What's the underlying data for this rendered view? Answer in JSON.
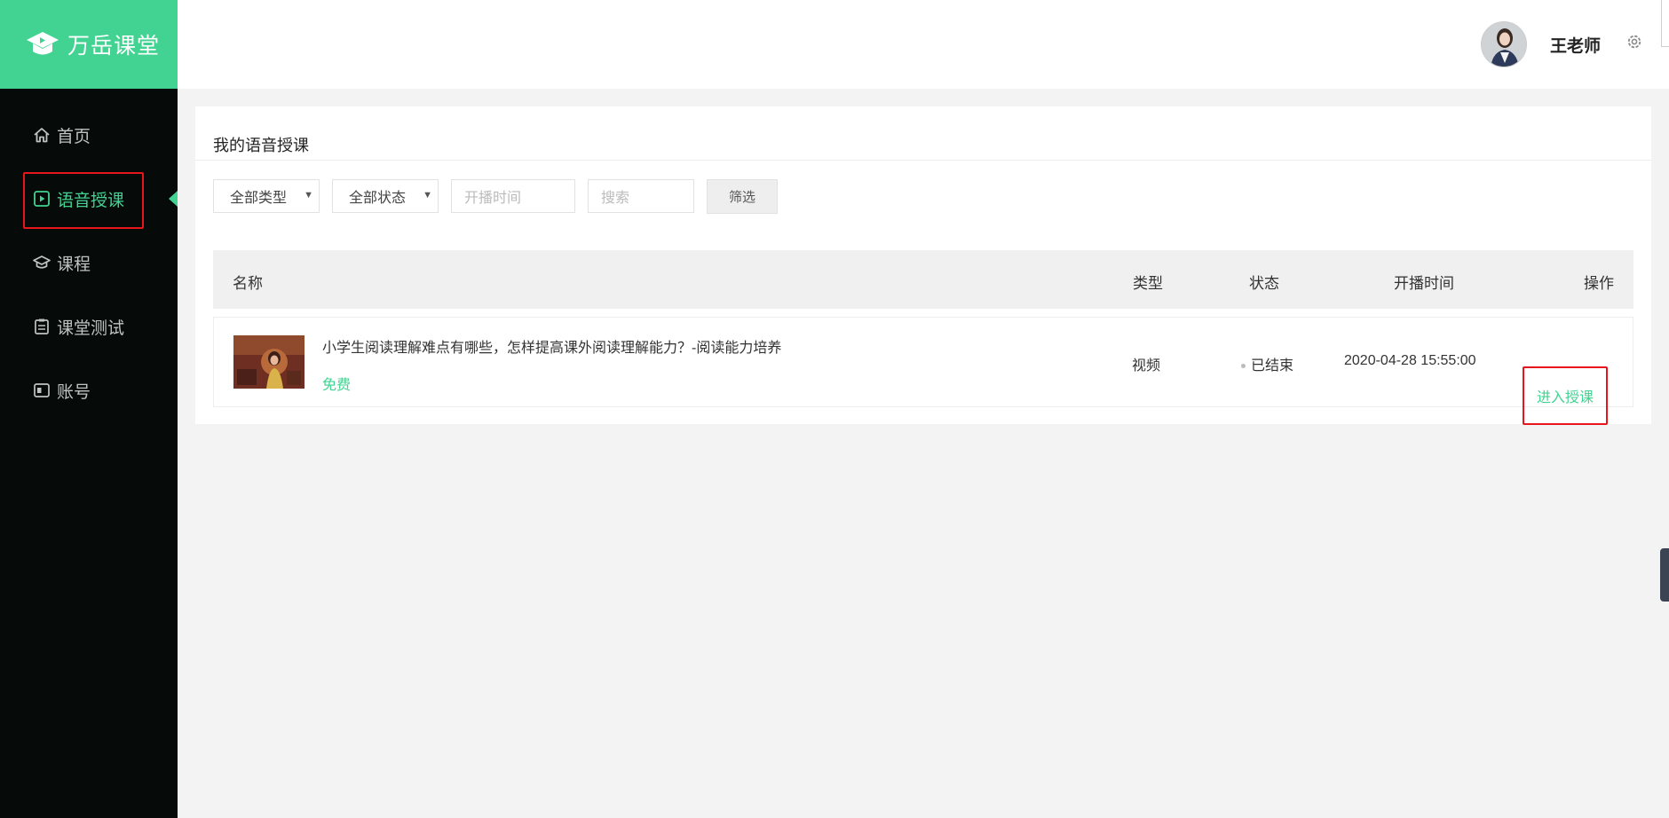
{
  "brand": {
    "name": "万岳课堂",
    "color": "#42d392",
    "icon": "graduation-cap-play-icon"
  },
  "sidebar": {
    "items": [
      {
        "label": "首页",
        "icon": "home-icon",
        "active": false
      },
      {
        "label": "语音授课",
        "icon": "play-square-icon",
        "active": true
      },
      {
        "label": "课程",
        "icon": "graduation-cap-icon",
        "active": false
      },
      {
        "label": "课堂测试",
        "icon": "clipboard-icon",
        "active": false
      },
      {
        "label": "账号",
        "icon": "id-card-icon",
        "active": false
      }
    ]
  },
  "header": {
    "user_name": "王老师",
    "avatar": "avatar-photo",
    "settings_icon": "gear-icon"
  },
  "page": {
    "title": "我的语音授课",
    "filters": {
      "type_select": "全部类型",
      "status_select": "全部状态",
      "time_placeholder": "开播时间",
      "search_placeholder": "搜索",
      "filter_button": "筛选"
    },
    "table": {
      "headers": {
        "name": "名称",
        "type": "类型",
        "status": "状态",
        "time": "开播时间",
        "action": "操作"
      },
      "rows": [
        {
          "title": "小学生阅读理解难点有哪些，怎样提高课外阅读理解能力？-阅读能力培养",
          "price": "免费",
          "type": "视频",
          "status": "已结束",
          "time": "2020-04-28 15:55:00",
          "action": "进入授课"
        }
      ]
    }
  },
  "colors": {
    "accent": "#42d392",
    "sidebar_bg": "#060a08",
    "highlight_red": "#e6161c"
  }
}
